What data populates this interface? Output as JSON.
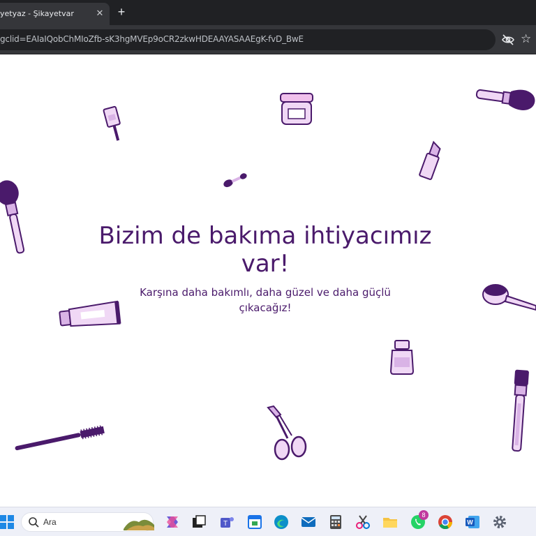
{
  "browser": {
    "tab_title": "yetyaz - Şikayetvar",
    "tab_close": "✕",
    "new_tab": "+",
    "address": "gclid=EAIaIQobChMIoZfb-sK3hgMVEp9oCR2zkwHDEAAYASAAEgK-fvD_BwE",
    "star": "☆"
  },
  "page": {
    "headline": "Bizim de bakıma ihtiyacımız var!",
    "subline": "Karşına daha bakımlı, daha güzel ve daha güçlü çıkacağız!",
    "accent_color": "#4a1a6b",
    "illustration_colors": [
      "#4a1a6b",
      "#d9b3e6",
      "#f0d8f5"
    ],
    "illustrations": [
      "nail-polish",
      "cream-jar",
      "powder-brush",
      "lipstick",
      "eyeshadow-applicator",
      "blush-brush",
      "cream-tube",
      "facial-cleansing-brush",
      "foundation-bottle",
      "mascara-wand",
      "eyelash-curler",
      "contour-brush"
    ]
  },
  "taskbar": {
    "search_placeholder": "Ara",
    "whatsapp_badge": "8",
    "apps": [
      "windows-start",
      "copilot",
      "task-view",
      "teams",
      "calendar",
      "edge",
      "mail",
      "calculator",
      "snipping-tool",
      "file-explorer",
      "whatsapp",
      "chrome",
      "word",
      "settings"
    ]
  }
}
